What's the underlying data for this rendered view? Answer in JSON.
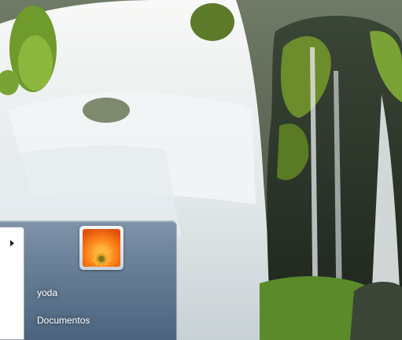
{
  "desktop": {
    "wallpaper": "waterfall-over-mossy-rocks"
  },
  "start_menu": {
    "programs_arrow_icon": "triangle-right-icon",
    "user_picture_icon": "orange-flower-icon",
    "right_items": [
      {
        "label": "yoda"
      },
      {
        "label": "Documentos"
      }
    ]
  }
}
